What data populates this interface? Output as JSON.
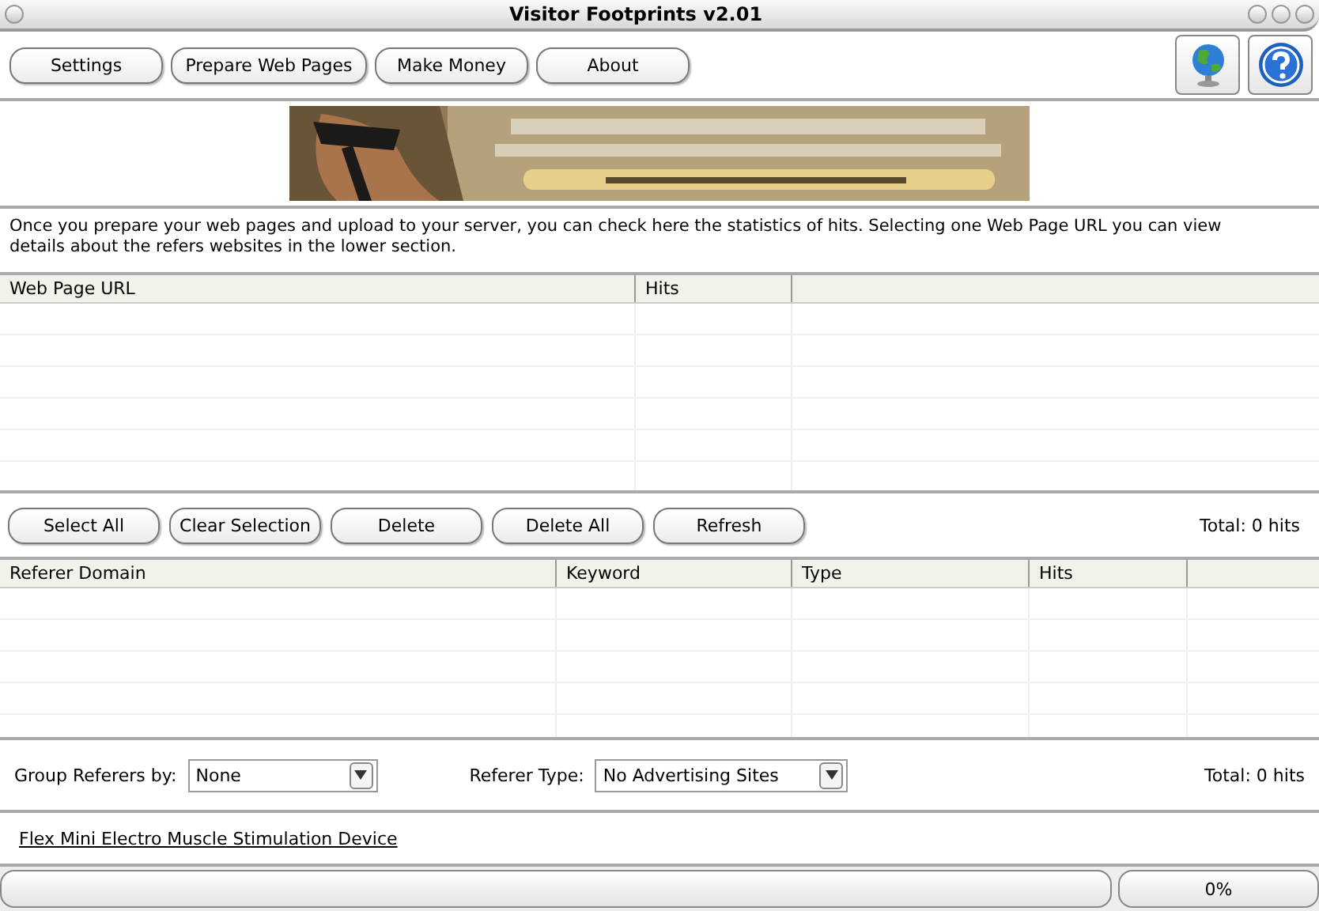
{
  "window": {
    "title": "Visitor Footprints v2.01"
  },
  "toolbar": {
    "buttons": [
      "Settings",
      "Prepare Web Pages",
      "Make Money",
      "About"
    ]
  },
  "description": "Once you prepare your web pages and upload to your server, you can check here the statistics of hits. Selecting one Web Page URL you can view details about the refers websites in the lower section.",
  "pages_table": {
    "columns": [
      "Web Page URL",
      "Hits"
    ]
  },
  "page_actions": {
    "buttons": [
      "Select All",
      "Clear Selection",
      "Delete",
      "Delete All",
      "Refresh"
    ],
    "total": "Total: 0 hits"
  },
  "referers_table": {
    "columns": [
      "Referer Domain",
      "Keyword",
      "Type",
      "Hits"
    ]
  },
  "filters": {
    "group_label": "Group Referers by:",
    "group_value": "None",
    "type_label": "Referer Type:",
    "type_value": "No Advertising Sites",
    "total": "Total: 0 hits"
  },
  "link": "Flex Mini Electro Muscle Stimulation Device",
  "status_bar": {
    "progress": {
      "level": 0,
      "reading": "0%"
    }
  }
}
